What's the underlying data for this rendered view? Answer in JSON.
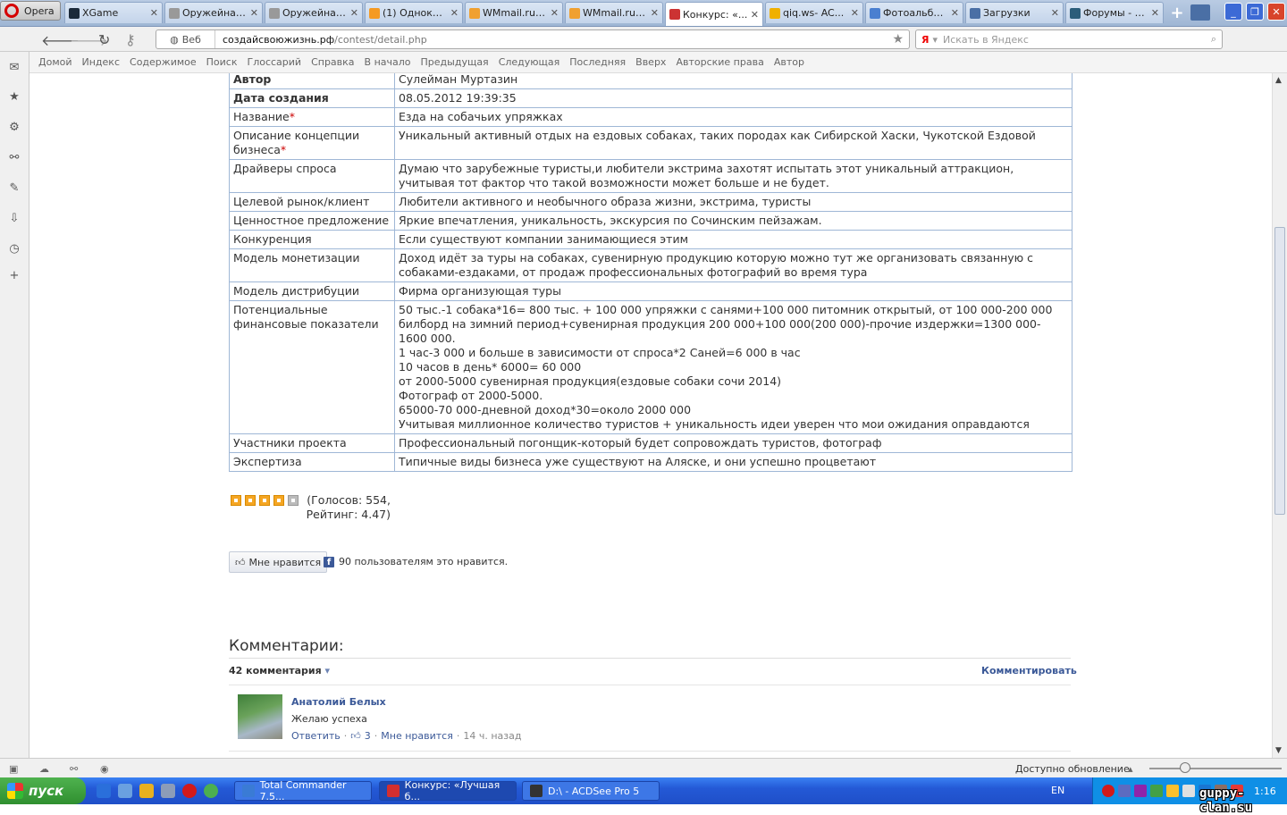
{
  "browser": {
    "menu_label": "Opera",
    "tabs": [
      {
        "label": "XGame",
        "icon": "xgame-icon",
        "color": "#1b2a3a"
      },
      {
        "label": "Оружейная...",
        "icon": "ex-icon",
        "color": "#999999"
      },
      {
        "label": "Оружейная...",
        "icon": "ex-icon",
        "color": "#999999"
      },
      {
        "label": "(1) Однокл...",
        "icon": "odnoklassniki-icon",
        "color": "#f59a23"
      },
      {
        "label": "WMmail.ru -...",
        "icon": "wmmail-icon",
        "color": "#f0a030"
      },
      {
        "label": "WMmail.ru -...",
        "icon": "wmmail-icon",
        "color": "#f0a030"
      },
      {
        "label": "Конкурс: «...",
        "icon": "page-icon",
        "color": "#c33"
      },
      {
        "label": "qiq.ws- AC...",
        "icon": "qiq-icon",
        "color": "#f0b000"
      },
      {
        "label": "Фотоальбо...",
        "icon": "photo-icon",
        "color": "#4a7fd0"
      },
      {
        "label": "Загрузки",
        "icon": "download-icon",
        "color": "#4a6fa5"
      },
      {
        "label": "Форумы - U...",
        "icon": "forum-icon",
        "color": "#2c5d7a"
      }
    ],
    "address": {
      "web_label": "Веб",
      "url_host": "создайсвоюжизнь.рф",
      "url_path": "/contest/detail.php"
    },
    "search": {
      "engine": "Я",
      "placeholder": "Искать в Яндекс"
    },
    "nav_links": [
      "Домой",
      "Индекс",
      "Содержимое",
      "Поиск",
      "Глоссарий",
      "Справка",
      "В начало",
      "Предыдущая",
      "Следующая",
      "Последняя",
      "Вверх",
      "Авторские права",
      "Автор"
    ]
  },
  "details": [
    {
      "label": "Автор",
      "value": "Сулейман Муртазин",
      "bold": true
    },
    {
      "label": "Дата создания",
      "value": "08.05.2012 19:39:35",
      "bold": true
    },
    {
      "label": "Название",
      "required": true,
      "value": "Езда на собачьих упряжках"
    },
    {
      "label": "Описание концепции бизнеса",
      "required": true,
      "value": "Уникальный активный отдых на ездовых собаках, таких породах как  Сибирской Хаски, Чукотской Ездовой"
    },
    {
      "label": "Драйверы спроса",
      "value": "Думаю что зарубежные туристы,и любители экстрима захотят испытать этот уникальный аттракцион, учитывая тот фактор что такой возможности может больше и не будет."
    },
    {
      "label": "Целевой рынок/клиент",
      "value": "Любители активного и необычного образа жизни, экстрима, туристы"
    },
    {
      "label": "Ценностное предложение",
      "value": "Яркие впечатления, уникальность, экскурсия по Сочинским пейзажам."
    },
    {
      "label": "Конкуренция",
      "value": "Если существуют компании занимающиеся этим"
    },
    {
      "label": "Модель монетизации",
      "value": "Доход идёт за туры на собаках, сувенирную продукцию которую можно тут же организовать связанную с собаками-ездаками, от продаж профессиональных фотографий во время тура"
    },
    {
      "label": "Модель дистрибуции",
      "value": "Фирма организующая туры"
    },
    {
      "label": "Потенциальные финансовые показатели",
      "value": "50 тыс.-1 собака*16= 800 тыс. + 100 000 упряжки с санями+100 000 питомник открытый, от 100 000-200 000 билборд на зимний период+сувенирная продукция 200 000+100 000(200 000)-прочие издержки=1300 000-1600 000.\n1 час-3 000 и больше в зависимости от спроса*2 Саней=6 000 в час\n10 часов в день* 6000= 60 000\nот 2000-5000 сувенирная продукция(ездовые собаки сочи 2014)\nФотограф от 2000-5000.\n65000-70 000-дневной доход*30=около 2000 000\nУчитывая миллионное количество туристов + уникальность идеи уверен что мои ожидания оправдаются"
    },
    {
      "label": "Участники проекта",
      "value": "Профессиональный погонщик-который будет сопровождать туристов, фотограф"
    },
    {
      "label": "Экспертиза",
      "value": "Типичные виды бизнеса уже существуют на Аляске, и они успешно процветают"
    }
  ],
  "rating": {
    "stars_filled": 4,
    "stars_total": 5,
    "votes_text": "(Голосов: 554, Рейтинг: 4.47)"
  },
  "like": {
    "button_label": "Мне нравится",
    "count_text": "90 пользователям это нравится."
  },
  "comments": {
    "heading": "Комментарии:",
    "count_label": "42 комментария",
    "post_label": "Комментировать",
    "items": [
      {
        "author": "Анатолий Белых",
        "text": "Желаю успеха",
        "reply_label": "Ответить",
        "likes": "3",
        "like_label": "Мне нравится",
        "time": "14 ч. назад"
      }
    ]
  },
  "status": {
    "update_label": "Доступно обновление"
  },
  "taskbar": {
    "start_label": "пуск",
    "tasks": [
      {
        "label": "Total Commander 7.5...",
        "color": "#3a7bd5"
      },
      {
        "label": "Конкурс: «Лучшая б...",
        "color": "#d32f2f"
      },
      {
        "label": "D:\\ - ACDSee Pro 5",
        "color": "#333333"
      }
    ],
    "lang": "EN",
    "clock": "1:16"
  },
  "watermark": "guppy-clan.su"
}
